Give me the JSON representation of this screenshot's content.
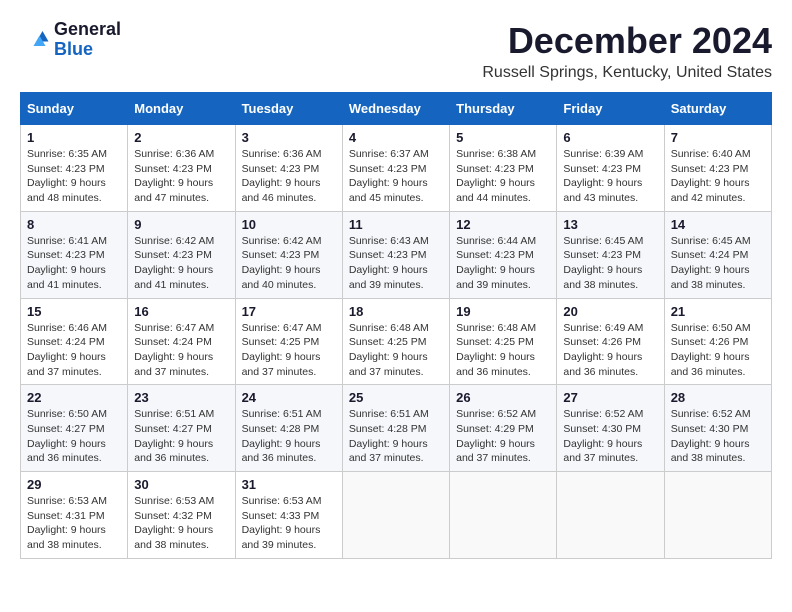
{
  "logo": {
    "line1": "General",
    "line2": "Blue"
  },
  "title": "December 2024",
  "subtitle": "Russell Springs, Kentucky, United States",
  "days_of_week": [
    "Sunday",
    "Monday",
    "Tuesday",
    "Wednesday",
    "Thursday",
    "Friday",
    "Saturday"
  ],
  "weeks": [
    [
      {
        "day": "1",
        "sunrise": "6:35 AM",
        "sunset": "4:23 PM",
        "daylight": "9 hours and 48 minutes."
      },
      {
        "day": "2",
        "sunrise": "6:36 AM",
        "sunset": "4:23 PM",
        "daylight": "9 hours and 47 minutes."
      },
      {
        "day": "3",
        "sunrise": "6:36 AM",
        "sunset": "4:23 PM",
        "daylight": "9 hours and 46 minutes."
      },
      {
        "day": "4",
        "sunrise": "6:37 AM",
        "sunset": "4:23 PM",
        "daylight": "9 hours and 45 minutes."
      },
      {
        "day": "5",
        "sunrise": "6:38 AM",
        "sunset": "4:23 PM",
        "daylight": "9 hours and 44 minutes."
      },
      {
        "day": "6",
        "sunrise": "6:39 AM",
        "sunset": "4:23 PM",
        "daylight": "9 hours and 43 minutes."
      },
      {
        "day": "7",
        "sunrise": "6:40 AM",
        "sunset": "4:23 PM",
        "daylight": "9 hours and 42 minutes."
      }
    ],
    [
      {
        "day": "8",
        "sunrise": "6:41 AM",
        "sunset": "4:23 PM",
        "daylight": "9 hours and 41 minutes."
      },
      {
        "day": "9",
        "sunrise": "6:42 AM",
        "sunset": "4:23 PM",
        "daylight": "9 hours and 41 minutes."
      },
      {
        "day": "10",
        "sunrise": "6:42 AM",
        "sunset": "4:23 PM",
        "daylight": "9 hours and 40 minutes."
      },
      {
        "day": "11",
        "sunrise": "6:43 AM",
        "sunset": "4:23 PM",
        "daylight": "9 hours and 39 minutes."
      },
      {
        "day": "12",
        "sunrise": "6:44 AM",
        "sunset": "4:23 PM",
        "daylight": "9 hours and 39 minutes."
      },
      {
        "day": "13",
        "sunrise": "6:45 AM",
        "sunset": "4:23 PM",
        "daylight": "9 hours and 38 minutes."
      },
      {
        "day": "14",
        "sunrise": "6:45 AM",
        "sunset": "4:24 PM",
        "daylight": "9 hours and 38 minutes."
      }
    ],
    [
      {
        "day": "15",
        "sunrise": "6:46 AM",
        "sunset": "4:24 PM",
        "daylight": "9 hours and 37 minutes."
      },
      {
        "day": "16",
        "sunrise": "6:47 AM",
        "sunset": "4:24 PM",
        "daylight": "9 hours and 37 minutes."
      },
      {
        "day": "17",
        "sunrise": "6:47 AM",
        "sunset": "4:25 PM",
        "daylight": "9 hours and 37 minutes."
      },
      {
        "day": "18",
        "sunrise": "6:48 AM",
        "sunset": "4:25 PM",
        "daylight": "9 hours and 37 minutes."
      },
      {
        "day": "19",
        "sunrise": "6:48 AM",
        "sunset": "4:25 PM",
        "daylight": "9 hours and 36 minutes."
      },
      {
        "day": "20",
        "sunrise": "6:49 AM",
        "sunset": "4:26 PM",
        "daylight": "9 hours and 36 minutes."
      },
      {
        "day": "21",
        "sunrise": "6:50 AM",
        "sunset": "4:26 PM",
        "daylight": "9 hours and 36 minutes."
      }
    ],
    [
      {
        "day": "22",
        "sunrise": "6:50 AM",
        "sunset": "4:27 PM",
        "daylight": "9 hours and 36 minutes."
      },
      {
        "day": "23",
        "sunrise": "6:51 AM",
        "sunset": "4:27 PM",
        "daylight": "9 hours and 36 minutes."
      },
      {
        "day": "24",
        "sunrise": "6:51 AM",
        "sunset": "4:28 PM",
        "daylight": "9 hours and 36 minutes."
      },
      {
        "day": "25",
        "sunrise": "6:51 AM",
        "sunset": "4:28 PM",
        "daylight": "9 hours and 37 minutes."
      },
      {
        "day": "26",
        "sunrise": "6:52 AM",
        "sunset": "4:29 PM",
        "daylight": "9 hours and 37 minutes."
      },
      {
        "day": "27",
        "sunrise": "6:52 AM",
        "sunset": "4:30 PM",
        "daylight": "9 hours and 37 minutes."
      },
      {
        "day": "28",
        "sunrise": "6:52 AM",
        "sunset": "4:30 PM",
        "daylight": "9 hours and 38 minutes."
      }
    ],
    [
      {
        "day": "29",
        "sunrise": "6:53 AM",
        "sunset": "4:31 PM",
        "daylight": "9 hours and 38 minutes."
      },
      {
        "day": "30",
        "sunrise": "6:53 AM",
        "sunset": "4:32 PM",
        "daylight": "9 hours and 38 minutes."
      },
      {
        "day": "31",
        "sunrise": "6:53 AM",
        "sunset": "4:33 PM",
        "daylight": "9 hours and 39 minutes."
      },
      null,
      null,
      null,
      null
    ]
  ]
}
